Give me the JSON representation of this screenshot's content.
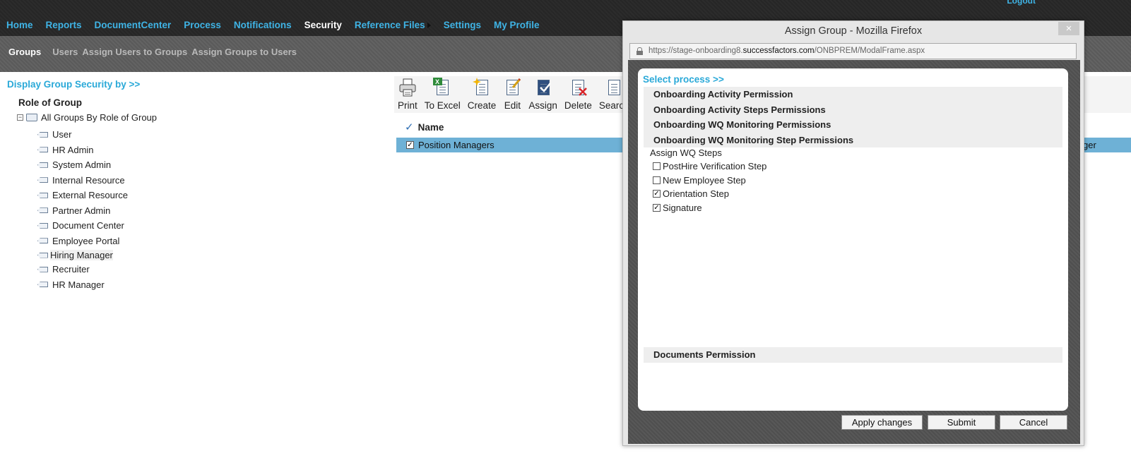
{
  "topnav": {
    "items": [
      "Home",
      "Reports",
      "DocumentCenter",
      "Process",
      "Notifications",
      "Security",
      "Reference Files",
      "Settings",
      "My Profile"
    ],
    "active": "Security",
    "logout": "Logout"
  },
  "subnav": {
    "items": [
      "Groups",
      "Users",
      "Assign Users to Groups",
      "Assign Groups to Users"
    ],
    "active": "Groups"
  },
  "left": {
    "display_link": "Display Group Security by >>",
    "tree_title": "Role of Group",
    "root_label": "All Groups By Role of Group",
    "items": [
      "User",
      "HR Admin",
      "System Admin",
      "Internal Resource",
      "External Resource",
      "Partner Admin",
      "Document Center",
      "Employee Portal",
      "Hiring Manager",
      "Recruiter",
      "HR Manager"
    ]
  },
  "toolbar": {
    "print": "Print",
    "excel": "To Excel",
    "create": "Create",
    "edit": "Edit",
    "assign": "Assign",
    "delete": "Delete",
    "search": "Search"
  },
  "grid": {
    "header": "Name",
    "row_name": "Position Managers",
    "row_right": "ger",
    "row_checked": true
  },
  "modal": {
    "title": "Assign Group - Mozilla Firefox",
    "close": "×",
    "url_prefix": "https://stage-onboarding8.",
    "url_domain": "successfactors.com",
    "url_path": "/ONBPREM/ModalFrame.aspx",
    "select_process": "Select process >>",
    "permissions": [
      "Onboarding Activity Permission",
      "Onboarding Activity Steps Permissions",
      "Onboarding WQ Monitoring Permissions",
      "Onboarding WQ Monitoring Step Permissions"
    ],
    "assign_steps_label": "Assign WQ Steps",
    "steps": [
      {
        "label": "PostHire Verification Step",
        "checked": false
      },
      {
        "label": "New Employee Step",
        "checked": false
      },
      {
        "label": "Orientation Step",
        "checked": true
      },
      {
        "label": "Signature",
        "checked": true
      }
    ],
    "documents_permission": "Documents Permission",
    "buttons": {
      "apply": "Apply changes",
      "submit": "Submit",
      "cancel": "Cancel"
    }
  },
  "colors": {
    "accent": "#3fb4e6",
    "link": "#2aa9d8",
    "selected_row": "#6eb1d6",
    "nav_bg": "#262626"
  }
}
